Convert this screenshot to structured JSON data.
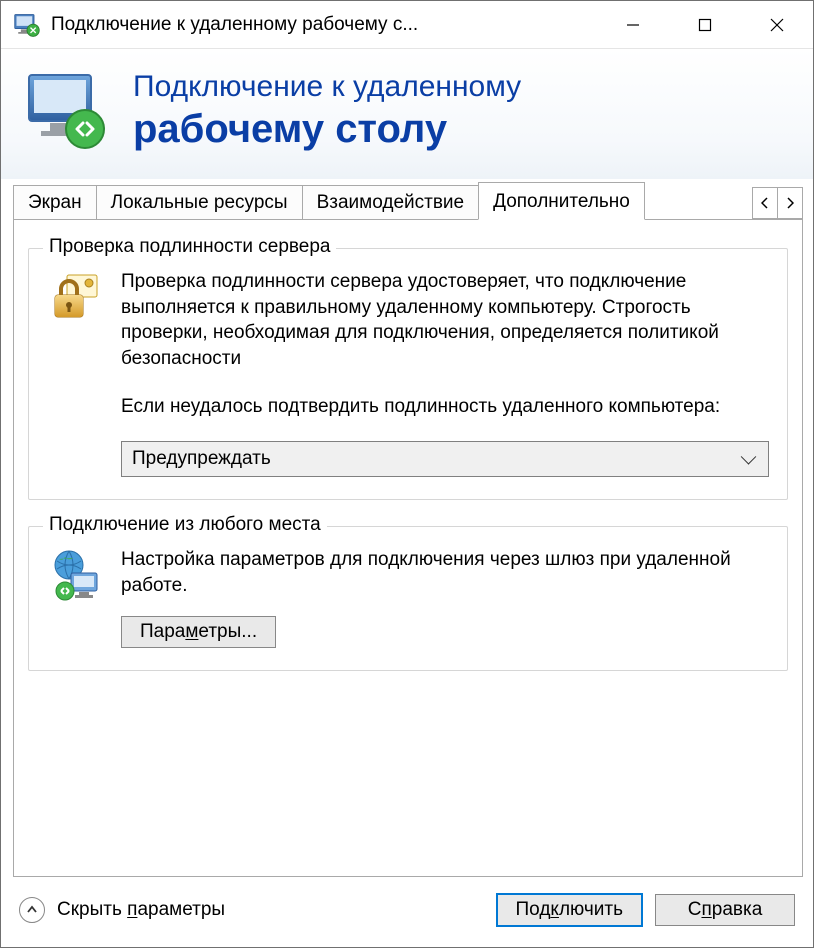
{
  "titlebar": {
    "title": "Подключение к удаленному рабочему с..."
  },
  "banner": {
    "line1": "Подключение к удаленному",
    "line2": "рабочему столу"
  },
  "tabs": {
    "items": [
      {
        "label": "Экран"
      },
      {
        "label": "Локальные ресурсы"
      },
      {
        "label": "Взаимодействие"
      },
      {
        "label": "Дополнительно"
      }
    ]
  },
  "auth_group": {
    "legend": "Проверка подлинности сервера",
    "para1": "Проверка подлинности сервера удостоверяет, что подключение выполняется к правильному удаленному компьютеру. Строгость проверки, необходимая для подключения, определяется политикой безопасности",
    "para2": "Если неудалось подтвердить подлинность удаленного компьютера:",
    "select_value": "Предупреждать"
  },
  "gateway_group": {
    "legend": "Подключение из любого места",
    "para": "Настройка параметров для подключения через шлюз при удаленной работе.",
    "button_prefix": "Пара",
    "button_hot": "м",
    "button_suffix": "етры..."
  },
  "footer": {
    "hide_prefix": "Скрыть ",
    "hide_hot": "п",
    "hide_suffix": "араметры",
    "connect_prefix": "Под",
    "connect_hot": "к",
    "connect_suffix": "лючить",
    "help_prefix": "С",
    "help_hot": "п",
    "help_suffix": "равка"
  }
}
